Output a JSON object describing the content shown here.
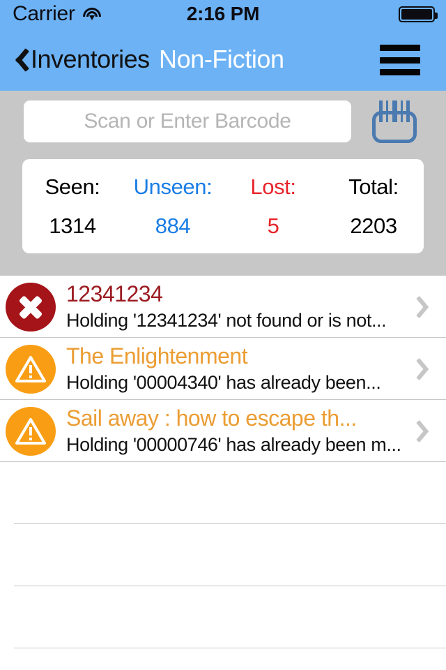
{
  "status_bar": {
    "carrier": "Carrier",
    "wifi_icon": "wifi-icon",
    "time": "2:16 PM",
    "battery_icon": "battery-full-icon"
  },
  "nav_bar": {
    "back_icon": "chevron-left-icon",
    "back_label": "Inventories",
    "title": "Non-Fiction",
    "menu_icon": "hamburger-menu-icon",
    "background_color": "#6cb2f5",
    "title_color": "#ffffff"
  },
  "search": {
    "value": "",
    "placeholder": "Scan or Enter Barcode",
    "barcode_icon": "barcode-scanner-icon",
    "barcode_icon_color": "#4a7ab0"
  },
  "stats": [
    {
      "label": "Seen:",
      "value": "1314",
      "color": "#000000"
    },
    {
      "label": "Unseen:",
      "value": "884",
      "color": "#1a7de5"
    },
    {
      "label": "Lost:",
      "value": "5",
      "color": "#e8232a"
    },
    {
      "label": "Total:",
      "value": "2203",
      "color": "#000000"
    }
  ],
  "list": {
    "rows": [
      {
        "icon": "error-circle-x-icon",
        "icon_type": "error",
        "icon_color": "#a41419",
        "title": "12341234",
        "title_color": "#9b1b20",
        "subtitle": "Holding '12341234' not found or is not...",
        "chevron_icon": "chevron-right-icon"
      },
      {
        "icon": "warning-triangle-icon",
        "icon_type": "warning",
        "icon_color": "#f99e14",
        "title": "The Enlightenment",
        "title_color": "#eb9d33",
        "subtitle": "Holding '00004340' has already been...",
        "chevron_icon": "chevron-right-icon"
      },
      {
        "icon": "warning-triangle-icon",
        "icon_type": "warning",
        "icon_color": "#f99e14",
        "title": "Sail away : how to escape th...",
        "title_color": "#eb9d33",
        "subtitle": "Holding '00000746' has already been m...",
        "chevron_icon": "chevron-right-icon"
      }
    ],
    "empty_row_count": 3
  },
  "colors": {
    "panel_background": "#c7c7c7",
    "separator": "#c8c8c8",
    "chevron": "#c6c6c6"
  }
}
